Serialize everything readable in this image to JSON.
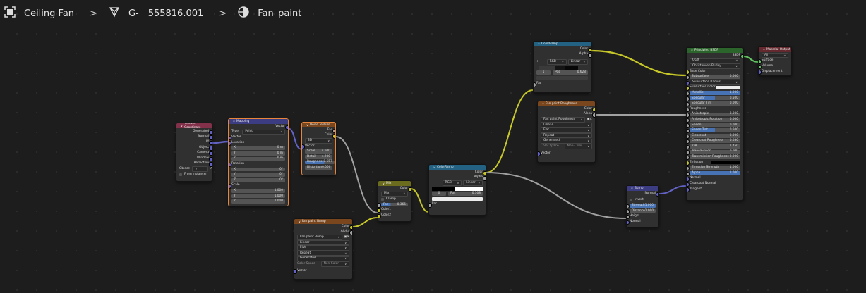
{
  "breadcrumb": {
    "items": [
      {
        "label": "Ceiling Fan",
        "icon": "object-icon"
      },
      {
        "label": "G-__555816.001",
        "icon": "mesh-icon"
      },
      {
        "label": "Fan_paint",
        "icon": "material-icon"
      }
    ]
  },
  "nodes": {
    "texcoord": {
      "title": "Texture Coordinate",
      "outputs": [
        "Generated",
        "Normal",
        "UV",
        "Object",
        "Camera",
        "Window",
        "Reflection"
      ],
      "object_label": "Object:",
      "from_instancer": "From Instancer"
    },
    "mapping": {
      "title": "Mapping",
      "out": "Vector",
      "type_label": "Type:",
      "type_value": "Point",
      "in_vector": "Vector",
      "location_label": "Location",
      "location": [
        "X",
        "0 m",
        "Y",
        "0 m",
        "Z",
        "0 m"
      ],
      "rotation_label": "Rotation",
      "rotation": [
        "X",
        "0°",
        "Y",
        "0°",
        "Z",
        "0°"
      ],
      "scale_label": "Scale",
      "scale": [
        "X",
        "1.000",
        "Y",
        "1.000",
        "Z",
        "1.000"
      ]
    },
    "noise": {
      "title": "Noise Texture",
      "outputs": [
        "Fac",
        "Color"
      ],
      "dim": "3D",
      "vector": "Vector",
      "fields": [
        [
          "Scale",
          "4.600"
        ],
        [
          "Detail",
          "4.200"
        ],
        [
          "Roughness",
          "0.657"
        ],
        [
          "Distortion",
          "0.000"
        ]
      ]
    },
    "mix": {
      "title": "Mix",
      "out": "Color",
      "blend": "Mix",
      "clamp": "Clamp",
      "fac_label": "Fac",
      "fac_value": "0.365",
      "inputs": [
        "Color1",
        "Color2"
      ]
    },
    "bumptex": {
      "title": "Fan paint Bump",
      "outputs": [
        "Color",
        "Alpha"
      ],
      "image": "Fan paint Bump",
      "opts": [
        "Linear",
        "Flat",
        "Repeat",
        "Generated"
      ],
      "cs_label": "Color Space",
      "cs_value": "Non-Color",
      "vector": "Vector"
    },
    "ramp1": {
      "title": "ColorRamp",
      "outputs": [
        "Color",
        "Alpha"
      ],
      "mode": "RGB",
      "interp": "Linear",
      "idx": "1",
      "pos_label": "Pos",
      "pos_value": "0.628",
      "fac": "Fac"
    },
    "ramp2": {
      "title": "ColorRamp",
      "outputs": [
        "Color",
        "Alpha"
      ],
      "mode": "RGB",
      "interp": "Linear",
      "idx": "0",
      "pos_label": "Pos",
      "pos_value": "0.308",
      "fac": "Fac"
    },
    "roughtex": {
      "title": "Fan paint Roughness",
      "outputs": [
        "Color",
        "Alpha"
      ],
      "image": "Fan paint Roughness",
      "opts": [
        "Linear",
        "Flat",
        "Repeat",
        "Generated"
      ],
      "cs_label": "Color Space",
      "cs_value": "Non-Color",
      "vector": "Vector"
    },
    "bump": {
      "title": "Bump",
      "out": "Normal",
      "invert": "Invert",
      "fields": [
        [
          "Strength",
          "1.000"
        ],
        [
          "Distance",
          "1.000"
        ]
      ],
      "inputs": [
        "Height",
        "Normal"
      ]
    },
    "bsdf": {
      "title": "Principled BSDF",
      "out": "BSDF",
      "dist": "GGX",
      "sss": "Christensen-Burley",
      "base_color": "Base Color",
      "f1": [
        [
          "Subsurface",
          "0.000"
        ]
      ],
      "sss_radius": "Subsurface Radius",
      "sss_color": "Subsurface Color",
      "f2": [
        [
          "Metallic",
          "1.000"
        ],
        [
          "Specular",
          "0.500"
        ],
        [
          "Specular Tint",
          "0.000"
        ]
      ],
      "roughness": "Roughness",
      "f3": [
        [
          "Anisotropic",
          "0.000"
        ],
        [
          "Anisotropic Rotation",
          "0.000"
        ],
        [
          "Sheen",
          "0.000"
        ],
        [
          "Sheen Tint",
          "0.500"
        ],
        [
          "Clearcoat",
          "0.000"
        ],
        [
          "Clearcoat Roughness",
          "0.030"
        ],
        [
          "IOR",
          "1.450"
        ],
        [
          "Transmission",
          "0.000"
        ],
        [
          "Transmission Roughness",
          "0.000"
        ]
      ],
      "emission": "Emission",
      "f4": [
        [
          "Emission Strength",
          "1.000"
        ],
        [
          "Alpha",
          "1.000"
        ]
      ],
      "inputs_end": [
        "Normal",
        "Clearcoat Normal",
        "Tangent"
      ]
    },
    "output": {
      "title": "Material Output",
      "target": "All",
      "inputs": [
        "Surface",
        "Volume",
        "Displacement"
      ]
    }
  },
  "colors": {
    "link_color": "#c7c729",
    "link_gray": "#a1a1a1",
    "link_vector": "#6363c7",
    "link_shader": "#63c763"
  }
}
